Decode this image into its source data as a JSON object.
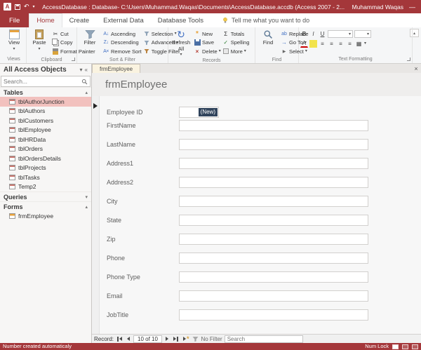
{
  "colors": {
    "brand": "#A4373A",
    "nav_selection": "#F2C1BE",
    "new_value_highlight": "#31445C"
  },
  "icons": {
    "app_letter": "A",
    "caret": "▾",
    "section_open": "▴",
    "section_closed": "▾",
    "shutter": "«",
    "close": "×",
    "cut": "✂",
    "ascending": "A↓",
    "descending": "Z↓",
    "remove_sort": "A×",
    "refresh": "↻",
    "new_star": "*",
    "delete_x": "×",
    "totals": "Σ",
    "spelling": "✓",
    "replace": "ab",
    "goto": "→",
    "select": "▶",
    "bold": "B",
    "italic": "I",
    "underline": "U",
    "font_color": "A",
    "align": "≡",
    "grid": "▦",
    "undo": "↶",
    "minimize": "—",
    "record_star": "*"
  },
  "titlebar": {
    "title": "AccessDatabase : Database- C:\\Users\\Muhammad.Waqas\\Documents\\AccessDatabase.accdb (Access 2007 - 2...",
    "user": "Muhammad Waqas"
  },
  "tabs": {
    "file": "File",
    "items": [
      "Home",
      "Create",
      "External Data",
      "Database Tools"
    ],
    "active": "Home",
    "tell_me": "Tell me what you want to do"
  },
  "ribbon": {
    "views": {
      "view": "View",
      "label": "Views"
    },
    "clipboard": {
      "paste": "Paste",
      "cut": "Cut",
      "copy": "Copy",
      "format_painter": "Format Painter",
      "label": "Clipboard"
    },
    "sort_filter": {
      "filter": "Filter",
      "ascending": "Ascending",
      "descending": "Descending",
      "remove_sort": "Remove Sort",
      "selection": "Selection",
      "advanced": "Advanced",
      "toggle_filter": "Toggle Filter",
      "label": "Sort & Filter"
    },
    "records": {
      "refresh_all": "Refresh All",
      "new": "New",
      "save": "Save",
      "delete": "Delete",
      "totals": "Totals",
      "spelling": "Spelling",
      "more": "More",
      "label": "Records"
    },
    "find_group": {
      "find": "Find",
      "replace": "Replace",
      "go_to": "Go To",
      "select": "Select",
      "label": "Find"
    },
    "text_formatting": {
      "label": "Text Formatting"
    }
  },
  "navpane": {
    "header": "All Access Objects",
    "search_placeholder": "Search...",
    "tables_label": "Tables",
    "queries_label": "Queries",
    "forms_label": "Forms",
    "tables": [
      "tblAuthorJunction",
      "tblAuthors",
      "tblCustomers",
      "tblEmployee",
      "tblHRData",
      "tblOrders",
      "tblOrdersDetails",
      "tblProjects",
      "tblTasks",
      "Temp2"
    ],
    "selected_table": "tblAuthorJunction",
    "forms": [
      "frmEmployee"
    ]
  },
  "document": {
    "tab_title": "frmEmployee",
    "form_title": "frmEmployee",
    "fields": [
      {
        "label": "Employee ID",
        "value": "(New)"
      },
      {
        "label": "FirstName",
        "value": ""
      },
      {
        "label": "LastName",
        "value": ""
      },
      {
        "label": "Address1",
        "value": ""
      },
      {
        "label": "Address2",
        "value": ""
      },
      {
        "label": "City",
        "value": ""
      },
      {
        "label": "State",
        "value": ""
      },
      {
        "label": "Zip",
        "value": ""
      },
      {
        "label": "Phone",
        "value": ""
      },
      {
        "label": "Phone Type",
        "value": ""
      },
      {
        "label": "Email",
        "value": ""
      },
      {
        "label": "JobTitle",
        "value": ""
      }
    ]
  },
  "record_nav": {
    "label": "Record:",
    "position": "10 of 10",
    "filter": "No Filter",
    "search_placeholder": "Search"
  },
  "statusbar": {
    "message": "Number created automaticaly",
    "num_lock": "Num Lock"
  }
}
